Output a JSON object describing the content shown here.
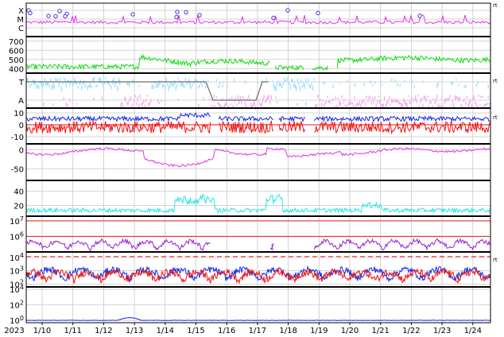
{
  "chart_data": {
    "type": "line",
    "start_year_label": "2023",
    "x_range": [
      "2023-01-09",
      "2023-01-24 20:00"
    ],
    "date_ticks": [
      "1/10",
      "1/11",
      "1/12",
      "1/13",
      "1/14",
      "1/15",
      "1/16",
      "1/17",
      "1/18",
      "1/19",
      "1/20",
      "1/21",
      "1/22",
      "1/23",
      "1/24"
    ],
    "grid": true,
    "colors": {
      "magenta": "#e632e6",
      "green": "#11dd11",
      "lightblue": "#a8e4ff",
      "pink": "#f4b6f0",
      "blue": "#1428e6",
      "red": "#ee1111",
      "cyan": "#22e6e6",
      "purple": "#9a1fd2",
      "gray": "#6e6e6e",
      "frame": "#000000"
    },
    "panels": [
      {
        "id": "flare-class",
        "y_ticks": [
          "X",
          "M",
          "C"
        ],
        "side_label": "rt",
        "series": [
          {
            "color": "magenta",
            "level": "C-M",
            "marker_count": 16
          }
        ]
      },
      {
        "id": "speed",
        "ylim": [
          350,
          750
        ],
        "y_ticks": [
          400,
          500,
          600,
          700
        ],
        "series": [
          {
            "color": "green",
            "range": [
              380,
              620
            ]
          }
        ]
      },
      {
        "id": "sector",
        "y_ticks": [
          "T",
          "A"
        ],
        "side_label": "rt",
        "series": [
          {
            "color": "lightblue",
            "value": "T"
          },
          {
            "color": "pink",
            "value": "A"
          },
          {
            "color": "gray",
            "value": "T-A-T",
            "transition": [
              "1/15",
              "1/17"
            ]
          }
        ]
      },
      {
        "id": "imf",
        "ylim": [
          -16,
          14
        ],
        "y_ticks": [
          -10,
          0,
          10
        ],
        "side_label": "rt",
        "reference_line": 0,
        "series": [
          {
            "color": "blue",
            "range": [
              2,
              10
            ]
          },
          {
            "color": "red",
            "range": [
              -10,
              6
            ]
          }
        ]
      },
      {
        "id": "dst",
        "ylim": [
          -80,
          15
        ],
        "y_ticks": [
          -50,
          0
        ],
        "series": [
          {
            "color": "magenta",
            "range": [
              -55,
              5
            ]
          }
        ]
      },
      {
        "id": "kp",
        "ylim": [
          5,
          55
        ],
        "y_ticks": [
          20,
          40
        ],
        "series": [
          {
            "color": "cyan",
            "range": [
              8,
              35
            ]
          }
        ]
      },
      {
        "id": "electron-flux",
        "scale": "log",
        "ylim": [
          "1e5",
          "1e7.3"
        ],
        "y_ticks": [
          "10^6",
          "10^7"
        ],
        "reference_lines": [
          "10^6",
          "10^7"
        ],
        "series": [
          {
            "color": "purple",
            "range": [
              "1e5",
              "1e6"
            ]
          }
        ]
      },
      {
        "id": "proton-flux",
        "scale": "log",
        "ylim": [
          "1e1.8",
          "1e4.4"
        ],
        "y_ticks": [
          "10^2",
          "10^3",
          "10^4"
        ],
        "side_label": "rt",
        "reference_line": "10^4 (dashed)",
        "series": [
          {
            "color": "blue",
            "range": [
              "1e2",
              "1e3"
            ]
          },
          {
            "color": "red",
            "range": [
              "1e2",
              "1e3"
            ]
          }
        ]
      },
      {
        "id": "particle-flux",
        "scale": "log",
        "ylim": [
          "1e-0.3",
          "1e4.3"
        ],
        "y_ticks": [
          "10^0",
          "10^2",
          "10^4"
        ],
        "series": [
          {
            "color": "blue",
            "baseline": "10^0",
            "peak": {
              "date": "1/12 16:00",
              "value": "1e0.35"
            }
          }
        ]
      }
    ]
  }
}
